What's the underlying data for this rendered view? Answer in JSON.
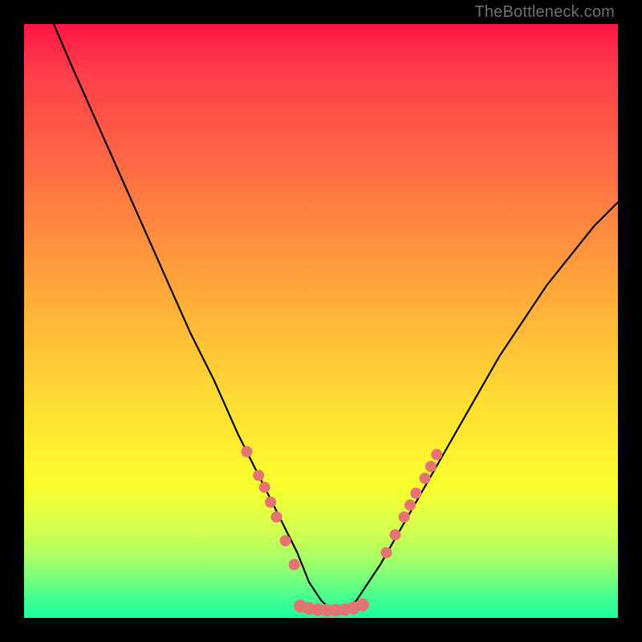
{
  "watermark": "TheBottleneck.com",
  "chart_data": {
    "type": "line",
    "title": "",
    "xlabel": "",
    "ylabel": "",
    "xlim": [
      0,
      100
    ],
    "ylim": [
      0,
      100
    ],
    "grid": false,
    "legend": false,
    "series": [
      {
        "name": "curve",
        "x": [
          5,
          8,
          12,
          16,
          20,
          24,
          28,
          32,
          36,
          40,
          42,
          44,
          46,
          48,
          50,
          52,
          54,
          56,
          60,
          64,
          68,
          72,
          76,
          80,
          84,
          88,
          92,
          96,
          100
        ],
        "y": [
          100,
          93,
          84,
          75,
          66,
          57,
          48,
          40,
          31,
          23,
          19,
          15,
          11,
          6,
          3,
          1,
          1,
          3,
          9,
          16,
          23,
          30,
          37,
          44,
          50,
          56,
          61,
          66,
          70
        ]
      }
    ],
    "markers": {
      "left": [
        {
          "x": 37.5,
          "y": 28
        },
        {
          "x": 39.5,
          "y": 24
        },
        {
          "x": 40.5,
          "y": 22
        },
        {
          "x": 41.5,
          "y": 19.5
        },
        {
          "x": 42.5,
          "y": 17
        },
        {
          "x": 44.0,
          "y": 13
        },
        {
          "x": 45.5,
          "y": 9
        }
      ],
      "floor": [
        {
          "x": 46.5,
          "y": 2
        },
        {
          "x": 48.0,
          "y": 1.6
        },
        {
          "x": 49.5,
          "y": 1.4
        },
        {
          "x": 51.0,
          "y": 1.3
        },
        {
          "x": 52.5,
          "y": 1.3
        },
        {
          "x": 54.0,
          "y": 1.4
        },
        {
          "x": 55.5,
          "y": 1.7
        },
        {
          "x": 57.0,
          "y": 2.2
        }
      ],
      "right": [
        {
          "x": 61.0,
          "y": 11
        },
        {
          "x": 62.5,
          "y": 14
        },
        {
          "x": 64.0,
          "y": 17
        },
        {
          "x": 65.0,
          "y": 19
        },
        {
          "x": 66.0,
          "y": 21
        },
        {
          "x": 67.5,
          "y": 23.5
        },
        {
          "x": 68.5,
          "y": 25.5
        },
        {
          "x": 69.5,
          "y": 27.5
        }
      ]
    },
    "background_gradient": {
      "top": "#ff1744",
      "middle": "#ffde33",
      "bottom": "#1affa0"
    }
  }
}
